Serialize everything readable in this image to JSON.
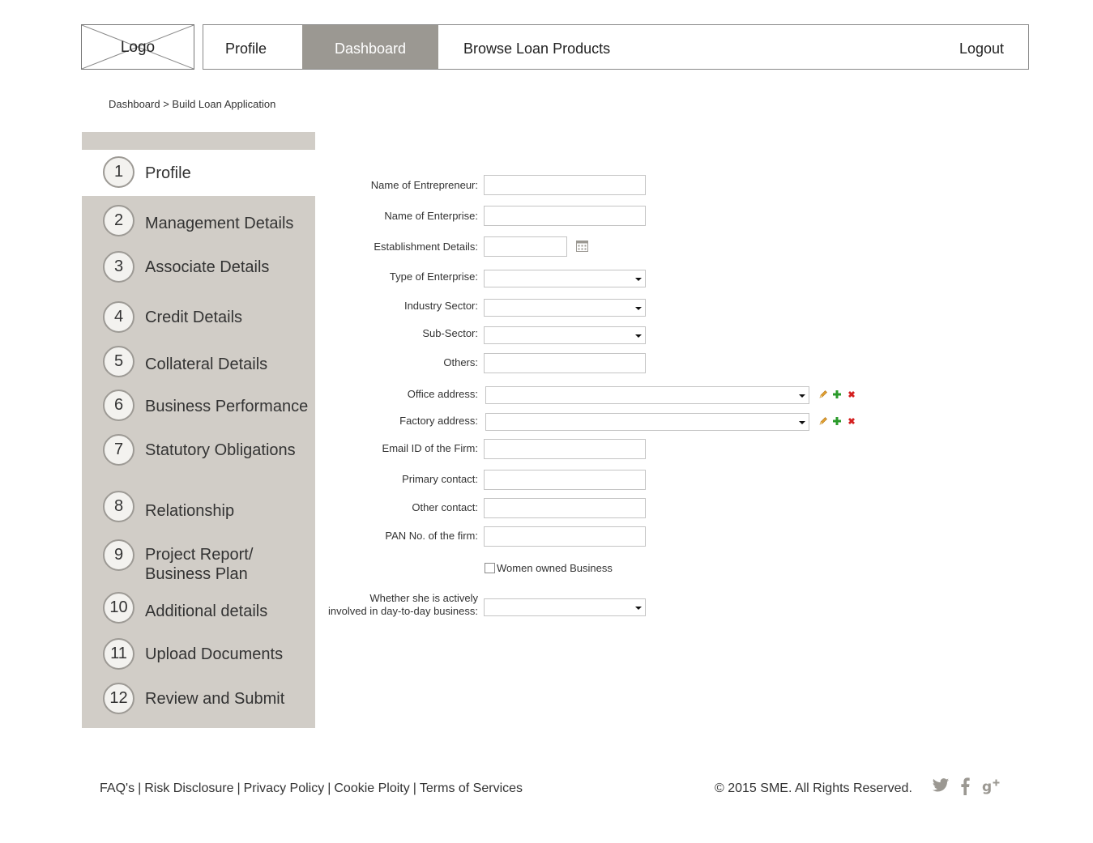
{
  "header": {
    "logo_text": "Logo",
    "nav": {
      "profile": "Profile",
      "dashboard": "Dashboard",
      "browse": "Browse Loan Products",
      "logout": "Logout"
    }
  },
  "breadcrumb": "Dashboard > Build Loan Application",
  "steps": [
    {
      "num": "1",
      "label": "Profile"
    },
    {
      "num": "2",
      "label": "Management Details"
    },
    {
      "num": "3",
      "label": "Associate Details"
    },
    {
      "num": "4",
      "label": "Credit Details"
    },
    {
      "num": "5",
      "label": "Collateral Details"
    },
    {
      "num": "6",
      "label": "Business Performance"
    },
    {
      "num": "7",
      "label": "Statutory Obligations"
    },
    {
      "num": "8",
      "label": "Relationship"
    },
    {
      "num": "9",
      "label_line1": "Project Report/",
      "label_line2": "Business Plan"
    },
    {
      "num": "10",
      "label": "Additional details"
    },
    {
      "num": "11",
      "label": "Upload Documents"
    },
    {
      "num": "12",
      "label": "Review and Submit"
    }
  ],
  "form": {
    "name_of_entrepreneur": "Name of Entrepreneur:",
    "name_of_enterprise": "Name of Enterprise:",
    "establishment_details": "Establishment Details:",
    "type_of_enterprise": "Type of Enterprise:",
    "industry_sector": "Industry Sector:",
    "sub_sector": "Sub-Sector:",
    "others": "Others:",
    "office_address": "Office address:",
    "factory_address": "Factory address:",
    "email_id": "Email ID of the Firm:",
    "primary_contact": "Primary contact:",
    "other_contact": "Other contact:",
    "pan_no": "PAN No. of the firm:",
    "women_owned": "Women owned Business",
    "actively_involved_line1": "Whether she is actively",
    "actively_involved_line2": "involved in day-to-day business:"
  },
  "footer": {
    "faqs": "FAQ's",
    "risk": "Risk Disclosure",
    "privacy": "Privacy Policy",
    "cookie": "Cookie Ploity",
    "terms": "Terms of Services",
    "separator": "|",
    "copyright": "© 2015 SME. All Rights Reserved."
  },
  "colors": {
    "nav_active_bg": "#9b9892",
    "sidebar_bg": "#d1cdc7",
    "icon_grey": "#9b9892",
    "edit_icon": "#e0a030",
    "add_icon": "#2a9a2a",
    "delete_icon": "#d42020"
  },
  "icons": {
    "calendar": "calendar-icon",
    "edit": "pencil-icon",
    "add": "plus-icon",
    "delete": "close-icon",
    "twitter": "twitter-icon",
    "facebook": "facebook-icon",
    "gplus": "google-plus-icon"
  }
}
